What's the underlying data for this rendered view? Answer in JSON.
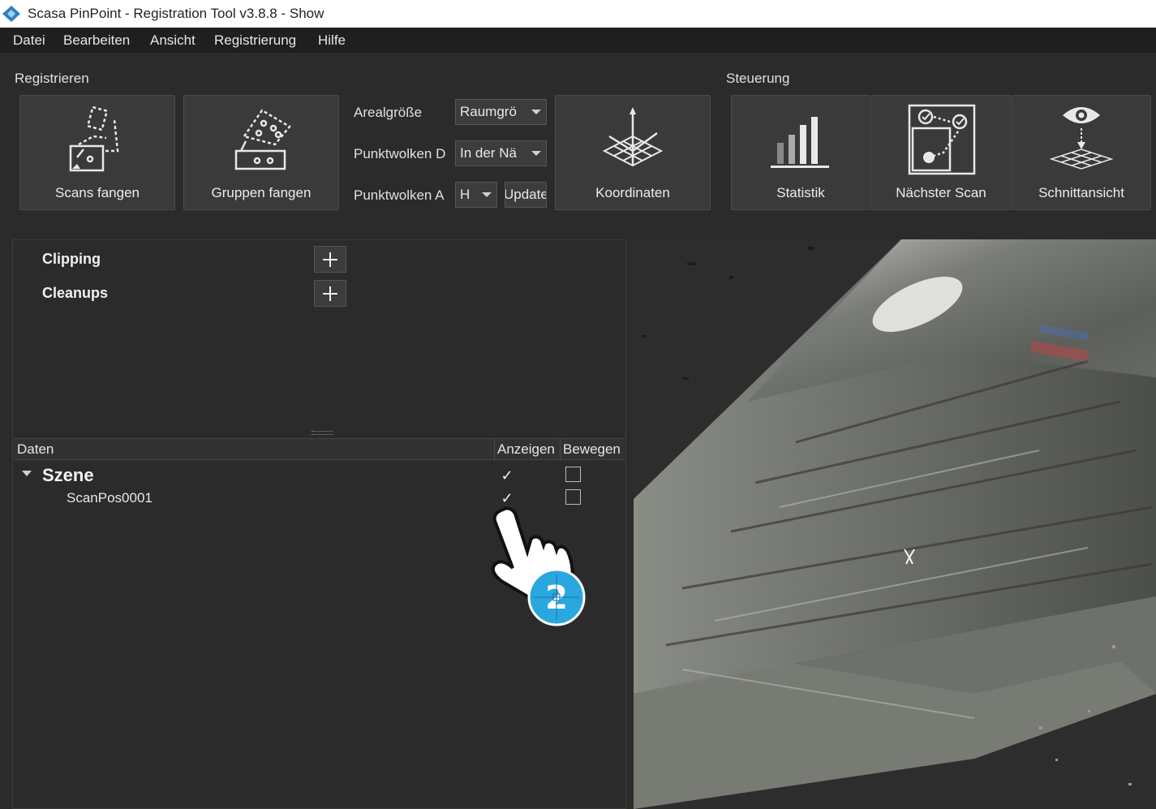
{
  "window": {
    "title": "Scasa PinPoint - Registration Tool v3.8.8 - Show"
  },
  "menu": {
    "items": [
      "Datei",
      "Bearbeiten",
      "Ansicht",
      "Registrierung",
      "Hilfe"
    ]
  },
  "ribbon": {
    "group_register": "Registrieren",
    "group_control": "Steuerung",
    "scans_fangen": "Scans fangen",
    "gruppen_fangen": "Gruppen fangen",
    "arealgroesse_label": "Arealgröße",
    "arealgroesse_value": "Raumgrö",
    "punktwolken_d_label": "Punktwolken D",
    "punktwolken_d_value": "In der Nä",
    "punktwolken_a_label": "Punktwolken A",
    "punktwolken_a_value": "H",
    "update_label": "Update",
    "koordinaten": "Koordinaten",
    "statistik": "Statistik",
    "naechster_scan": "Nächster Scan",
    "schnittansicht": "Schnittansicht"
  },
  "panel": {
    "clipping": "Clipping",
    "cleanups": "Cleanups"
  },
  "tree": {
    "columns": [
      "Daten",
      "Anzeigen",
      "Bewegen"
    ],
    "rows": [
      {
        "label": "Szene",
        "anzeigen": true,
        "bewegen": false
      },
      {
        "label": "ScanPos0001",
        "anzeigen": true,
        "bewegen": false
      }
    ],
    "check_glyph": "✓"
  },
  "cursor_badge": "2",
  "colors": {
    "accent": "#2aa7df",
    "background": "#2b2b2b",
    "menubar": "#1f1f1f"
  }
}
